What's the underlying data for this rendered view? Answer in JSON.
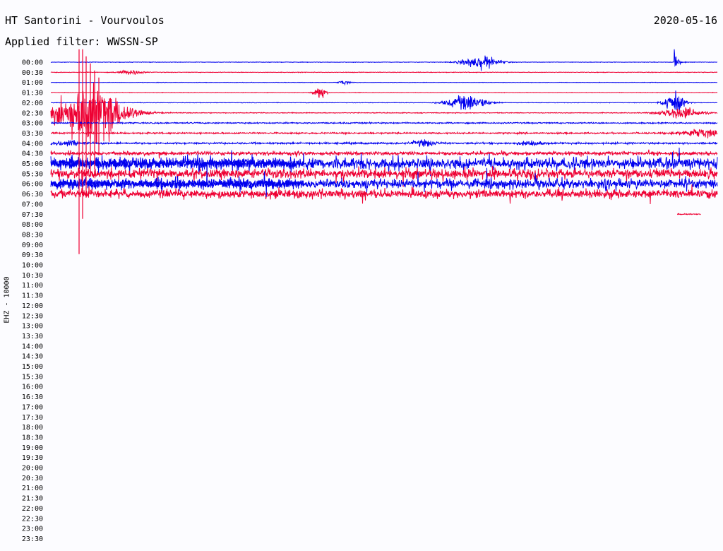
{
  "header": {
    "station": "HT Santorini - Vourvoulos",
    "date": "2020-05-16",
    "filter": "Applied filter: WWSSN-SP",
    "channel_label": "EHZ - 10000"
  },
  "chart_data": {
    "type": "line",
    "title": "HT Santorini - Vourvoulos",
    "subtitle": "Applied filter: WWSSN-SP",
    "ylabel": "EHZ - 10000",
    "date": "2020-05-16",
    "colors": {
      "even_row": "#0000ee",
      "odd_row": "#ee0033"
    },
    "row_labels": [
      "00:00",
      "00:30",
      "01:00",
      "01:30",
      "02:00",
      "02:30",
      "03:00",
      "03:30",
      "04:00",
      "04:30",
      "05:00",
      "05:30",
      "06:00",
      "06:30",
      "07:00",
      "07:30",
      "08:00",
      "08:30",
      "09:00",
      "09:30",
      "10:00",
      "10:30",
      "11:00",
      "11:30",
      "12:00",
      "12:30",
      "13:00",
      "13:30",
      "14:00",
      "14:30",
      "15:00",
      "15:30",
      "16:00",
      "16:30",
      "17:00",
      "17:30",
      "18:00",
      "18:30",
      "19:00",
      "19:30",
      "20:00",
      "20:30",
      "21:00",
      "21:30",
      "22:00",
      "22:30",
      "23:00",
      "23:30"
    ],
    "traces": [
      {
        "row": "00:00",
        "noise": 0.5,
        "events": [
          {
            "at": 0.645,
            "amp": 14,
            "width": 0.018
          },
          {
            "at": 0.935,
            "amp": 30,
            "width": 0.004,
            "oneSided": true
          }
        ]
      },
      {
        "row": "00:30",
        "noise": 0.6,
        "events": [
          {
            "at": 0.12,
            "amp": 5,
            "width": 0.012
          }
        ]
      },
      {
        "row": "01:00",
        "noise": 0.4,
        "events": [
          {
            "at": 0.44,
            "amp": 4,
            "width": 0.006
          }
        ]
      },
      {
        "row": "01:30",
        "noise": 0.5,
        "events": [
          {
            "at": 0.403,
            "amp": 14,
            "width": 0.006
          }
        ]
      },
      {
        "row": "02:00",
        "noise": 0.5,
        "events": [
          {
            "at": 0.625,
            "amp": 16,
            "width": 0.02
          },
          {
            "at": 0.935,
            "amp": 22,
            "width": 0.01
          }
        ]
      },
      {
        "row": "02:30",
        "noise": 0.8,
        "events": [
          {
            "at": 0.06,
            "amp": 60,
            "width": 0.035
          },
          {
            "at": 0.945,
            "amp": 12,
            "width": 0.02
          }
        ]
      },
      {
        "row": "03:00",
        "noise": 1.3,
        "events": []
      },
      {
        "row": "03:30",
        "noise": 1.6,
        "events": [
          {
            "at": 0.975,
            "amp": 8,
            "width": 0.02
          }
        ]
      },
      {
        "row": "04:00",
        "noise": 1.8,
        "events": [
          {
            "at": 0.025,
            "amp": 6,
            "width": 0.012
          },
          {
            "at": 0.56,
            "amp": 6,
            "width": 0.012
          },
          {
            "at": 0.72,
            "amp": 4,
            "width": 0.012
          }
        ]
      },
      {
        "row": "04:30",
        "noise": 3.5,
        "events": []
      },
      {
        "row": "05:00",
        "noise": 11,
        "events": []
      },
      {
        "row": "05:30",
        "noise": 9,
        "events": []
      },
      {
        "row": "06:00",
        "noise": 9,
        "events": []
      },
      {
        "row": "06:30",
        "noise": 8,
        "events": []
      },
      {
        "row": "07:30",
        "noise": 1.2,
        "events": []
      }
    ],
    "partial_segments": [
      {
        "row": "05:00",
        "color": "#0000ee",
        "from": 0.0,
        "to": 0.38
      },
      {
        "row": "06:00",
        "color": "#0000ee",
        "from": 0.0,
        "to": 0.38
      },
      {
        "row": "07:30",
        "color": "#ee0033",
        "from": 0.94,
        "to": 0.975
      }
    ]
  }
}
